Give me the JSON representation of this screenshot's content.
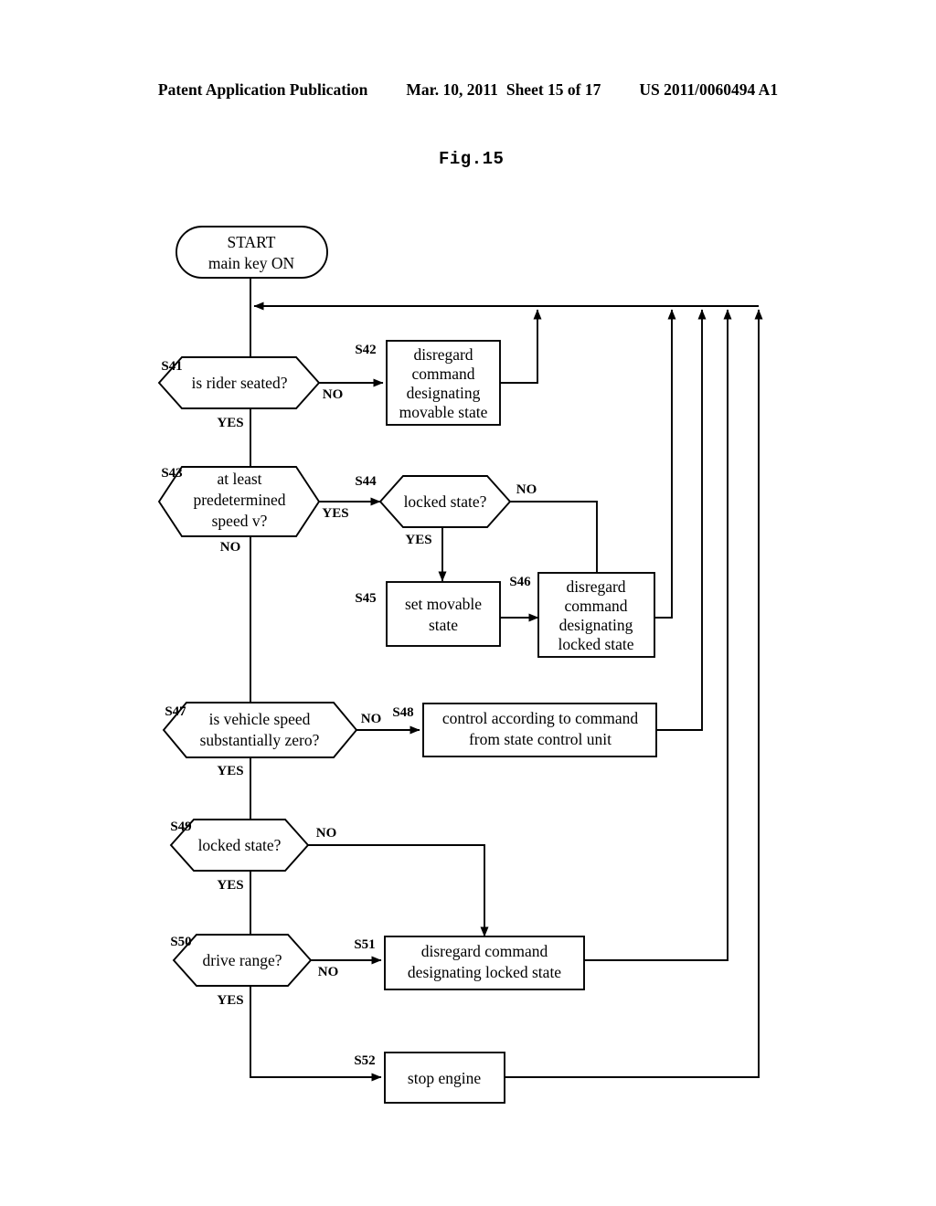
{
  "header": {
    "publication": "Patent Application Publication",
    "date": "Mar. 10, 2011",
    "sheet": "Sheet 15 of 17",
    "number": "US 2011/0060494 A1"
  },
  "figure": {
    "label": "Fig.15"
  },
  "flowchart": {
    "start": {
      "line1": "START",
      "line2": "main key ON"
    },
    "steps": [
      {
        "id": "S41",
        "tag": "S41",
        "shape": "hexagon",
        "lines": [
          "is rider seated?"
        ],
        "yes": "YES",
        "no": "NO"
      },
      {
        "id": "S42",
        "tag": "S42",
        "shape": "rect",
        "lines": [
          "disregard",
          "command",
          "designating",
          "movable state"
        ]
      },
      {
        "id": "S43",
        "tag": "S43",
        "shape": "hexagon",
        "lines": [
          "at least",
          "predetermined",
          "speed v?"
        ],
        "yes": "YES",
        "no": "NO"
      },
      {
        "id": "S44",
        "tag": "S44",
        "shape": "hexagon",
        "lines": [
          "locked state?"
        ],
        "yes": "YES",
        "no": "NO"
      },
      {
        "id": "S45",
        "tag": "S45",
        "shape": "rect",
        "lines": [
          "set movable",
          "state"
        ]
      },
      {
        "id": "S46",
        "tag": "S46",
        "shape": "rect",
        "lines": [
          "disregard",
          "command",
          "designating",
          "locked state"
        ]
      },
      {
        "id": "S47",
        "tag": "S47",
        "shape": "hexagon",
        "lines": [
          "is vehicle speed",
          "substantially zero?"
        ],
        "yes": "YES",
        "no": "NO"
      },
      {
        "id": "S48",
        "tag": "S48",
        "shape": "rect",
        "lines": [
          "control according to command",
          "from state control unit"
        ]
      },
      {
        "id": "S49",
        "tag": "S49",
        "shape": "hexagon",
        "lines": [
          "locked state?"
        ],
        "yes": "YES",
        "no": "NO"
      },
      {
        "id": "S50",
        "tag": "S50",
        "shape": "hexagon",
        "lines": [
          "drive range?"
        ],
        "yes": "YES",
        "no": "NO"
      },
      {
        "id": "S51",
        "tag": "S51",
        "shape": "rect",
        "lines": [
          "disregard command",
          "designating locked state"
        ]
      },
      {
        "id": "S52",
        "tag": "S52",
        "shape": "rect",
        "lines": [
          "stop engine"
        ]
      }
    ]
  },
  "colors": {
    "ink": "#000000",
    "paper": "#ffffff"
  }
}
